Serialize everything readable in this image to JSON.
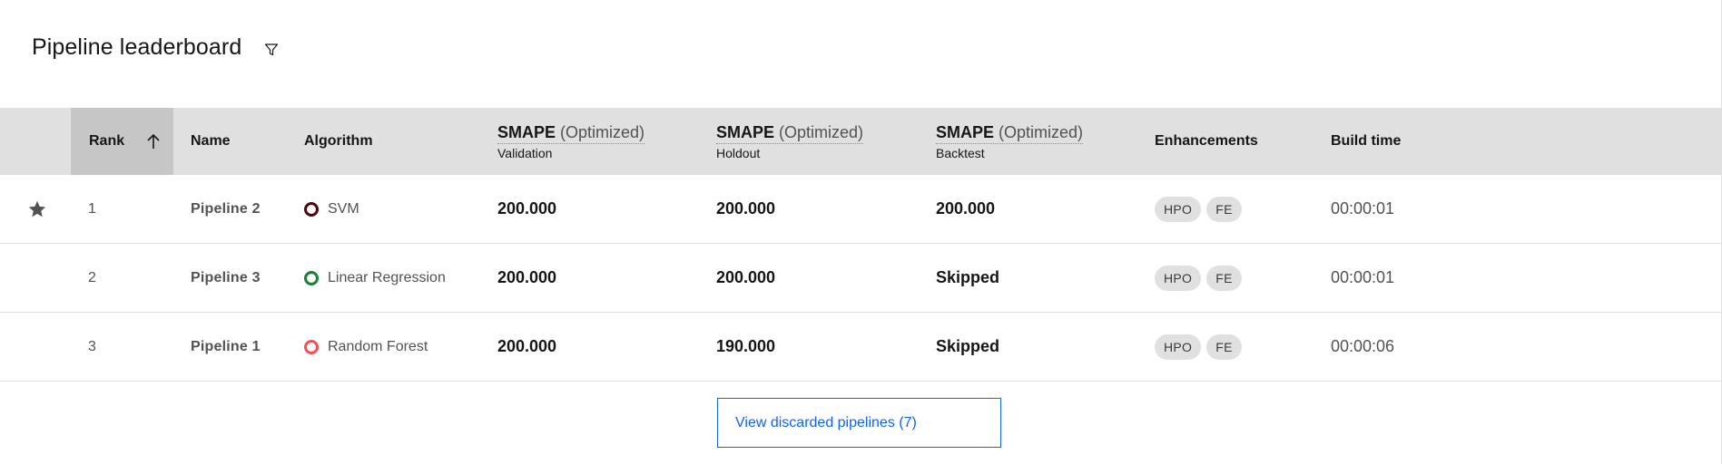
{
  "header": {
    "title": "Pipeline leaderboard",
    "filter_icon": "filter-icon"
  },
  "columns": {
    "rank": "Rank",
    "name": "Name",
    "algorithm": "Algorithm",
    "metric1": {
      "name": "SMAPE",
      "qualifier": "(Optimized)",
      "sub": "Validation"
    },
    "metric2": {
      "name": "SMAPE",
      "qualifier": "(Optimized)",
      "sub": "Holdout"
    },
    "metric3": {
      "name": "SMAPE",
      "qualifier": "(Optimized)",
      "sub": "Backtest"
    },
    "enhancements": "Enhancements",
    "build_time": "Build time"
  },
  "sort": {
    "column": "Rank",
    "direction": "ascending",
    "icon": "arrow-up-icon"
  },
  "rows": [
    {
      "starred": true,
      "rank": "1",
      "name": "Pipeline 2",
      "algorithm": "SVM",
      "algo_color": "#520408",
      "validation": "200.000",
      "holdout": "200.000",
      "backtest": "200.000",
      "enhancements": [
        "HPO",
        "FE"
      ],
      "build_time": "00:00:01"
    },
    {
      "starred": false,
      "rank": "2",
      "name": "Pipeline 3",
      "algorithm": "Linear Regression",
      "algo_color": "#198038",
      "validation": "200.000",
      "holdout": "200.000",
      "backtest": "Skipped",
      "enhancements": [
        "HPO",
        "FE"
      ],
      "build_time": "00:00:01"
    },
    {
      "starred": false,
      "rank": "3",
      "name": "Pipeline 1",
      "algorithm": "Random Forest",
      "algo_color": "#fa4d56",
      "validation": "200.000",
      "holdout": "190.000",
      "backtest": "Skipped",
      "enhancements": [
        "HPO",
        "FE"
      ],
      "build_time": "00:00:06"
    }
  ],
  "footer": {
    "discarded_button": "View discarded pipelines (7)"
  },
  "colors": {
    "header_bg": "#e0e0e0",
    "sorted_header_bg": "#c6c6c6",
    "link": "#0f62fe",
    "tag_bg": "#e0e0e0"
  }
}
